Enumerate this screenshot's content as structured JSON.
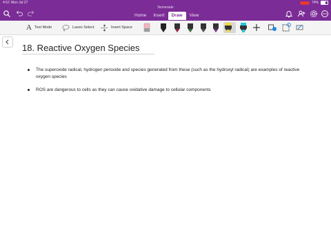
{
  "status_bar": {
    "time": "4:52",
    "date": "Mon Jul 27",
    "battery": "74%"
  },
  "app": {
    "title": "Numerade"
  },
  "ribbon": {
    "tabs": [
      {
        "label": "Home",
        "active": false
      },
      {
        "label": "Insert",
        "active": false
      },
      {
        "label": "Draw",
        "active": true
      },
      {
        "label": "View",
        "active": false
      }
    ]
  },
  "toolbar": {
    "text_mode": "Text Mode",
    "lasso_select": "Lasso Select",
    "insert_space": "Insert Space",
    "pens": [
      {
        "name": "pen-black",
        "color": "#222222"
      },
      {
        "name": "pen-magenta",
        "color": "#c2185b"
      },
      {
        "name": "pen-green",
        "color": "#2e7d32"
      },
      {
        "name": "pen-dark",
        "color": "#333333"
      },
      {
        "name": "pen-purple",
        "color": "#8e24aa"
      },
      {
        "name": "highlighter-yellow",
        "color": "#fdd835"
      },
      {
        "name": "highlighter-cyan",
        "color": "#26c6da"
      }
    ]
  },
  "page": {
    "title": "18. Reactive Oxygen Species",
    "bullets": [
      "The superoxide radical, hydrogen peroxide and species generated from these (such as the hydroxyl radical) are examples of reactive oxygen species",
      "ROS are dangerous to cells as they can cause oxidative damage to cellular components"
    ]
  },
  "colors": {
    "accent": "#7b2c96"
  }
}
